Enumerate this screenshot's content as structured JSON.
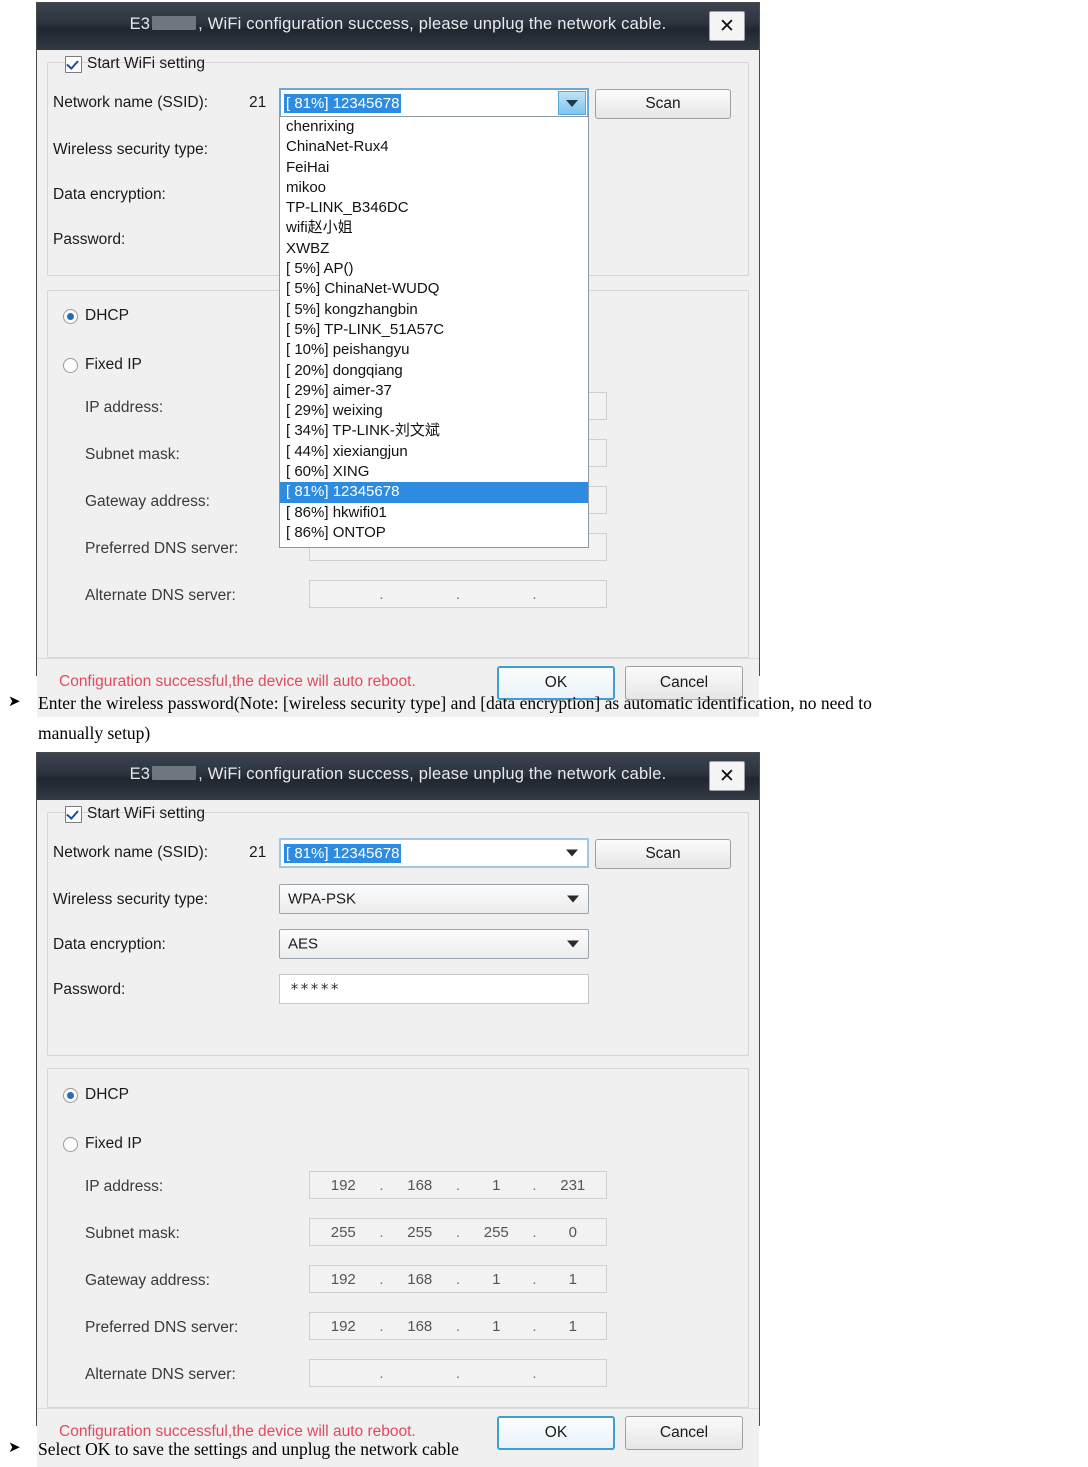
{
  "dialog": {
    "title_prefix": "E3",
    "title_rest": ", WiFi configuration success, please unplug the network cable.",
    "close_icon": "close-icon",
    "start_wifi_label": "Start WiFi setting",
    "labels": {
      "ssid": "Network name (SSID):",
      "ssid_count": "21",
      "security_type": "Wireless security type:",
      "data_encryption": "Data encryption:",
      "password": "Password:",
      "dhcp": "DHCP",
      "fixed_ip": "Fixed IP",
      "ip_address": "IP address:",
      "subnet_mask": "Subnet mask:",
      "gateway": "Gateway address:",
      "preferred_dns": "Preferred DNS server:",
      "alternate_dns": "Alternate DNS server:"
    },
    "buttons": {
      "scan": "Scan",
      "ok": "OK",
      "cancel": "Cancel"
    },
    "status_text": "Configuration successful,the device will auto reboot."
  },
  "ssid_selected": "[ 81%] 12345678",
  "ssid_list": [
    "chenrixing",
    "ChinaNet-Rux4",
    "FeiHai",
    "mikoo",
    "TP-LINK_B346DC",
    "wifi赵小姐",
    "XWBZ",
    "[  5%] AP()",
    "[  5%] ChinaNet-WUDQ",
    "[  5%] kongzhangbin",
    "[  5%] TP-LINK_51A57C",
    "[ 10%] peishangyu",
    "[ 20%] dongqiang",
    "[ 29%] aimer-37",
    "[ 29%] weixing",
    "[ 34%] TP-LINK-刘文斌",
    "[ 44%] xiexiangjun",
    "[ 60%] XING",
    "[ 81%] 12345678",
    "[ 86%] hkwifi01",
    "[ 86%] ONTOP"
  ],
  "ssid_selected_index": 18,
  "dialog2": {
    "security_type_value": "WPA-PSK",
    "data_encryption_value": "AES",
    "password_value": "*****",
    "ip_address": [
      "192",
      "168",
      "1",
      "231"
    ],
    "subnet_mask": [
      "255",
      "255",
      "255",
      "0"
    ],
    "gateway": [
      "192",
      "168",
      "1",
      "1"
    ],
    "preferred_dns": [
      "192",
      "168",
      "1",
      "1"
    ],
    "alternate_dns": [
      "",
      "",
      "",
      ""
    ]
  },
  "instructions": {
    "bullet_glyph": "➤",
    "line1": "Enter the wireless password(Note: [wireless security type] and [data encryption] as automatic identification, no need to",
    "line1b": "manually setup)",
    "line2": "Select OK to save the settings and unplug the network cable"
  },
  "colors": {
    "accent": "#2d8ce0",
    "status": "#e04a5f",
    "titlebar": "#2c333d"
  }
}
